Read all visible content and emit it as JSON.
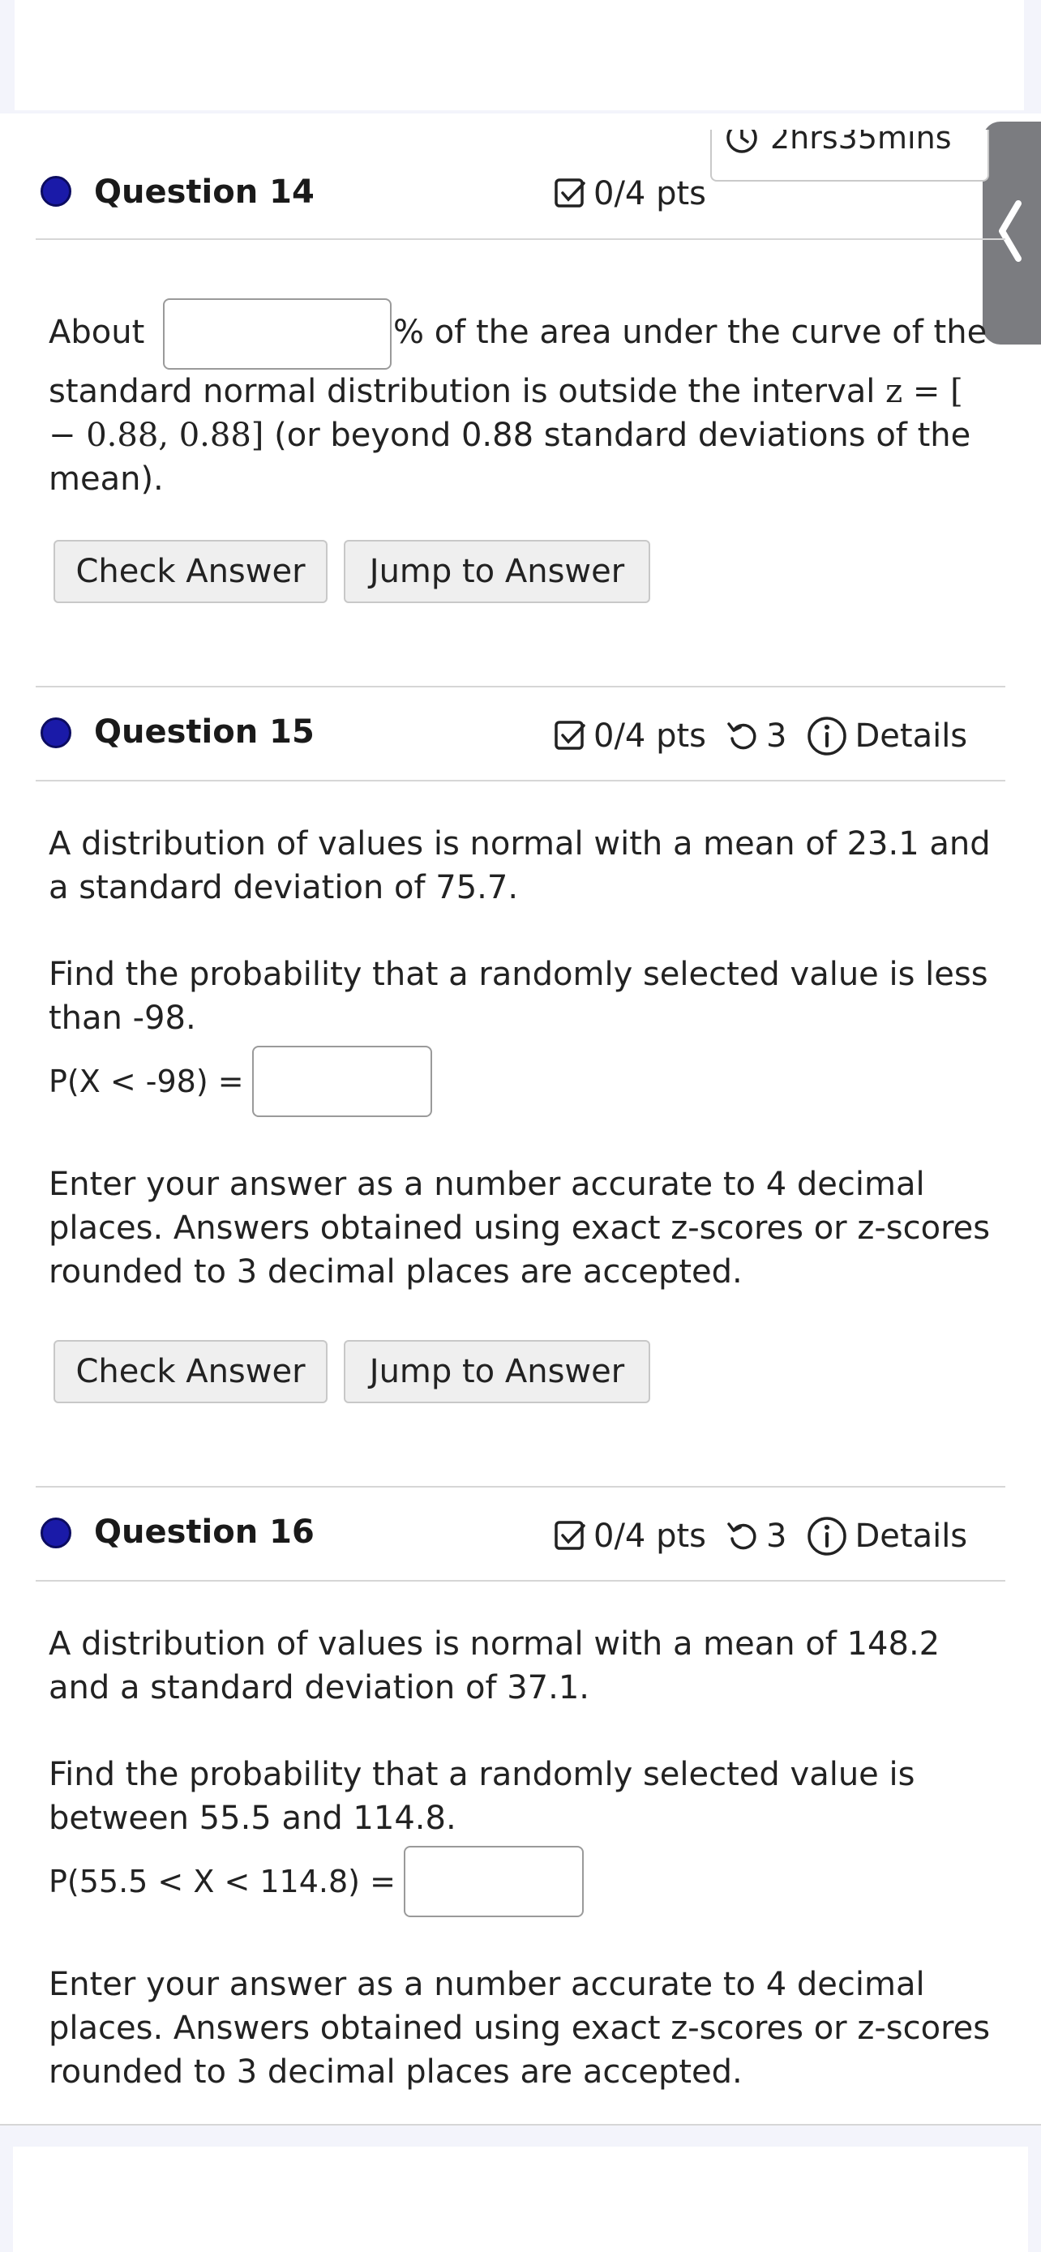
{
  "timer": {
    "text": "2hrs35mins"
  },
  "questions": [
    {
      "title": "Question 14",
      "points": "0/4 pts",
      "attempts": "3",
      "details": "Details",
      "text_before_input": "About",
      "text_after_input": "% of the area under the curve of the standard normal distribution is outside the interval",
      "math": "z = [ − 0.88, 0.88]",
      "text_after_math": "(or beyond 0.88 standard deviations of the mean).",
      "check_label": "Check Answer",
      "jump_label": "Jump to Answer"
    },
    {
      "title": "Question 15",
      "points": "0/4 pts",
      "attempts": "3",
      "details": "Details",
      "para1": "A distribution of values is normal with a mean of 23.1 and a standard deviation of 75.7.",
      "para2": "Find the probability that a randomly selected value is less than -98.",
      "prob_label": "P(X < -98) =",
      "para3": "Enter your answer as a number accurate to 4 decimal places. Answers obtained using exact z-scores or z-scores rounded to 3 decimal places are accepted.",
      "check_label": "Check Answer",
      "jump_label": "Jump to Answer"
    },
    {
      "title": "Question 16",
      "points": "0/4 pts",
      "attempts": "3",
      "details": "Details",
      "para1": "A distribution of values is normal with a mean of 148.2 and a standard deviation of 37.1.",
      "para2": "Find the probability that a randomly selected value is between 55.5 and 114.8.",
      "prob_label": "P(55.5 < X < 114.8) =",
      "para3": "Enter your answer as a number accurate to 4 decimal places. Answers obtained using exact z-scores or z-scores rounded to 3 decimal places are accepted."
    }
  ],
  "colors": {
    "status_dot": "#1a1aa8",
    "side_handle": "#7b7c80"
  }
}
